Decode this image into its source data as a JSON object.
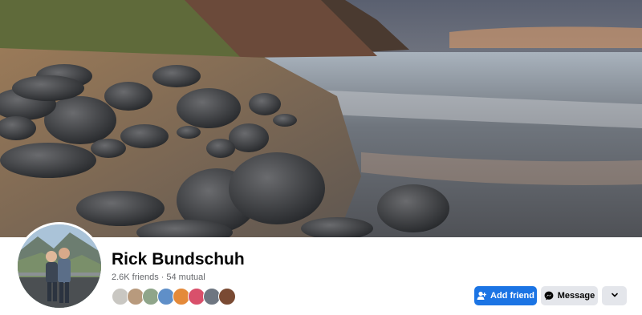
{
  "profile": {
    "name": "Rick Bundschuh",
    "friends_count": "2.6K friends",
    "separator": "·",
    "mutual_count": "54 mutual"
  },
  "cover": {
    "description_icon": "beach-photo"
  },
  "mutual_friend_avatars": [
    {
      "color": "#c9c7c2"
    },
    {
      "color": "#b89a7d"
    },
    {
      "color": "#8fa58a"
    },
    {
      "color": "#5f8fc8"
    },
    {
      "color": "#e48a3a"
    },
    {
      "color": "#d9506b"
    },
    {
      "color": "#6e7681"
    },
    {
      "color": "#7a4a33"
    }
  ],
  "actions": {
    "add_friend_label": "Add friend",
    "add_friend_icon": "add-person-icon",
    "message_label": "Message",
    "message_icon": "messenger-icon",
    "more_icon": "chevron-down-icon"
  },
  "colors": {
    "primary": "#1b74e4",
    "secondary_bg": "#e4e6eb",
    "text_primary": "#050505",
    "text_secondary": "#65676b"
  }
}
